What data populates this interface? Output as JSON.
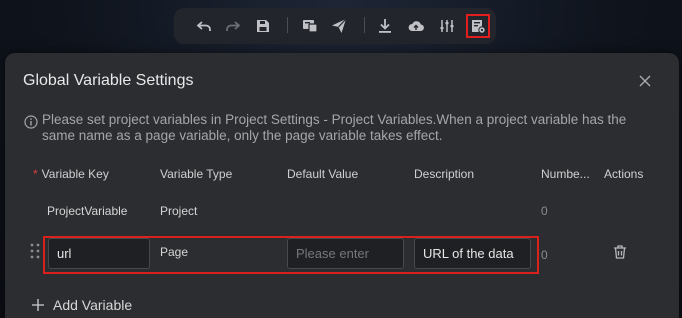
{
  "toolbar": {
    "buttons": [
      {
        "icon": "undo-icon"
      },
      {
        "icon": "redo-icon"
      },
      {
        "icon": "save-icon"
      },
      {
        "icon": "preview-icon"
      },
      {
        "icon": "publish-icon"
      },
      {
        "icon": "download-icon"
      },
      {
        "icon": "upload-cloud-icon"
      },
      {
        "icon": "settings-sliders-icon"
      },
      {
        "icon": "variable-settings-icon",
        "active": true
      }
    ]
  },
  "dialog": {
    "title": "Global Variable Settings",
    "info": "Please set project variables in Project Settings - Project Variables.When a project variable has the same name as a page variable, only the page variable takes effect.",
    "columns": {
      "required_mark": "*",
      "key": "Variable Key",
      "type": "Variable Type",
      "default": "Default Value",
      "description": "Description",
      "number": "Numbe...",
      "actions": "Actions"
    },
    "rows": [
      {
        "key": "ProjectVariable",
        "type": "Project",
        "number": "0"
      },
      {
        "key": "url",
        "type": "Page",
        "default_value": "",
        "default_placeholder": "Please enter",
        "description": "URL of the data",
        "number": "0"
      }
    ],
    "add_label": "Add Variable"
  },
  "colors": {
    "highlight": "#d9211d",
    "required": "#e0413c",
    "dialog_bg": "#2b2d31"
  }
}
